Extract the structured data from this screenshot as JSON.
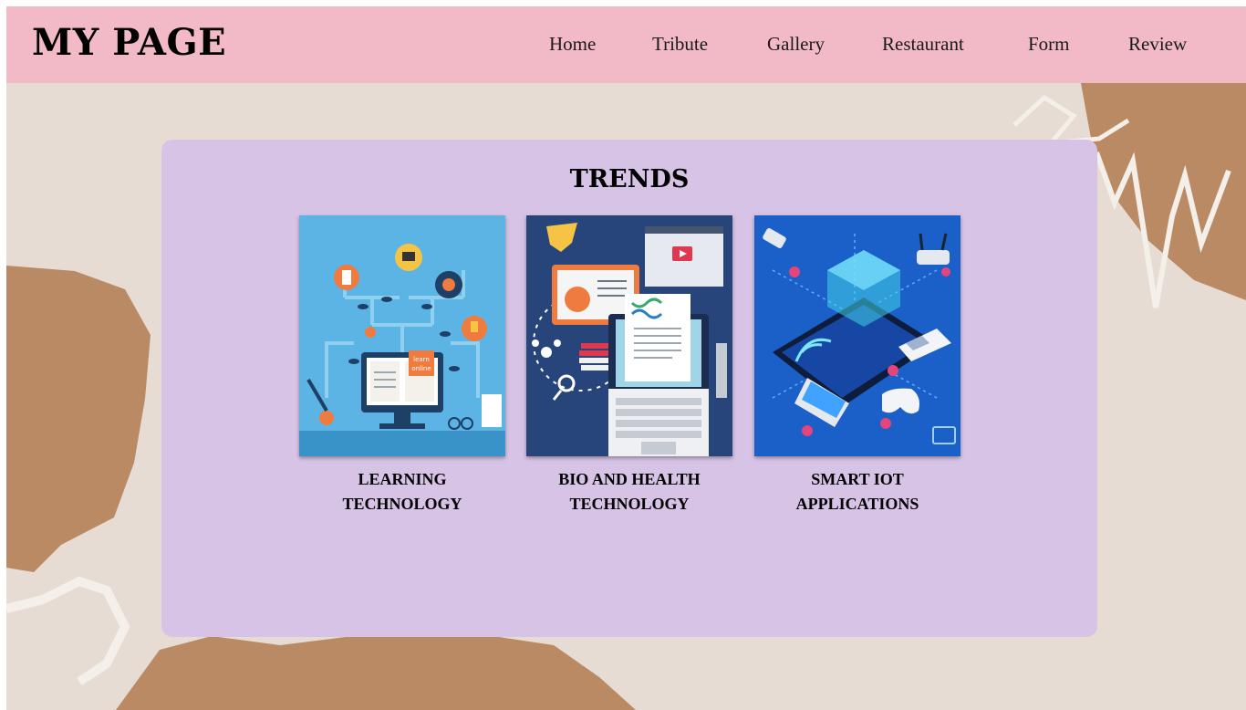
{
  "header": {
    "brand": "MY PAGE",
    "nav": [
      {
        "label": "Home"
      },
      {
        "label": "Tribute"
      },
      {
        "label": "Gallery"
      },
      {
        "label": "Restaurant"
      },
      {
        "label": "Form"
      },
      {
        "label": "Review"
      }
    ]
  },
  "main": {
    "title": "TRENDS",
    "cards": [
      {
        "caption": "LEARNING TECHNOLOGY",
        "image_icon": "learning-illustration",
        "badge": "learn online"
      },
      {
        "caption": "BIO AND HEALTH TECHNOLOGY",
        "image_icon": "biotech-illustration"
      },
      {
        "caption": "SMART IOT APPLICATIONS",
        "image_icon": "iot-illustration"
      }
    ]
  },
  "colors": {
    "navbar": "#f2bac6",
    "panel": "#d7c3e6",
    "background": "#e6dcd4",
    "paper_brown": "#b98a63"
  }
}
